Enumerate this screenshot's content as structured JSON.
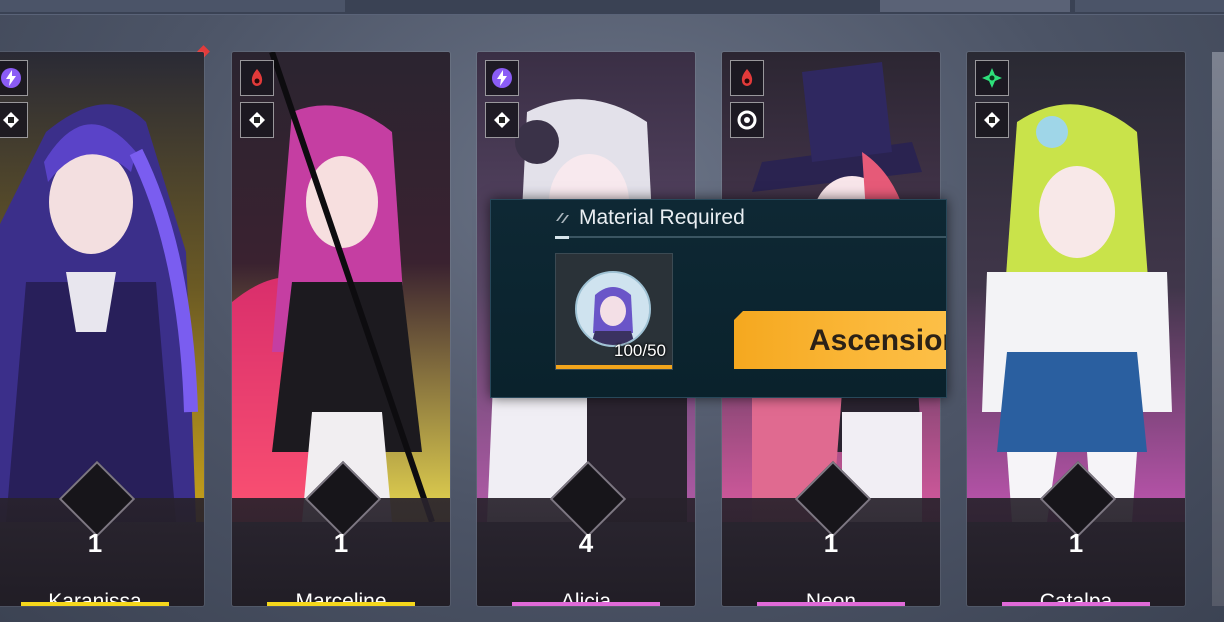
{
  "popup": {
    "title": "Material Required",
    "material_count": "100/50",
    "ascension_label": "Ascension"
  },
  "cards": [
    {
      "name": "Karanissa",
      "rank": "1",
      "stars": "★★★★★★",
      "element_icon": "lightning-icon",
      "class_icon": "fist-icon",
      "element_color": "#8b5cf6",
      "bar_color": "#f5d71c"
    },
    {
      "name": "Marceline",
      "rank": "1",
      "stars": "★★★★★★",
      "element_icon": "fire-icon",
      "class_icon": "fist-icon",
      "element_color": "#e33a3a",
      "bar_color": "#f5d71c"
    },
    {
      "name": "Alicia",
      "rank": "4",
      "stars": "★★★★★★",
      "element_icon": "lightning-icon",
      "class_icon": "fist-icon",
      "element_color": "#8b5cf6",
      "bar_color": "#e06ad8"
    },
    {
      "name": "Neon",
      "rank": "1",
      "stars": "★★★★★★",
      "element_icon": "fire-icon",
      "class_icon": "ring-icon",
      "element_color": "#e33a3a",
      "bar_color": "#e06ad8"
    },
    {
      "name": "Catalpa",
      "rank": "1",
      "stars": "★★★★★★",
      "element_icon": "wind-icon",
      "class_icon": "fist-icon",
      "element_color": "#2ee07a",
      "bar_color": "#e06ad8"
    }
  ]
}
